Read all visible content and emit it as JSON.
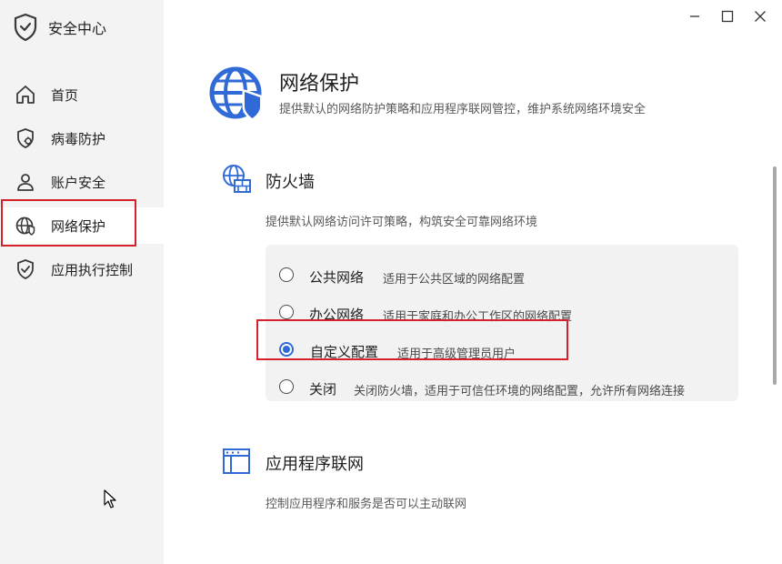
{
  "app": {
    "title": "安全中心"
  },
  "sidebar": {
    "items": [
      {
        "label": "首页",
        "icon": "home-icon",
        "active": false
      },
      {
        "label": "病毒防护",
        "icon": "shield-virus-icon",
        "active": false
      },
      {
        "label": "账户安全",
        "icon": "user-icon",
        "active": false
      },
      {
        "label": "网络保护",
        "icon": "network-globe-shield-icon",
        "active": true
      },
      {
        "label": "应用执行控制",
        "icon": "shield-check-icon",
        "active": false
      }
    ]
  },
  "window_controls": {
    "minimize": "minimize-icon",
    "maximize": "maximize-icon",
    "close": "close-icon"
  },
  "header": {
    "title": "网络保护",
    "subtitle": "提供默认的网络防护策略和应用程序联网管控，维护系统网络环境安全",
    "icon": "globe-shield-icon"
  },
  "firewall": {
    "title": "防火墙",
    "description": "提供默认网络访问许可策略，构筑安全可靠网络环境",
    "icon": "globe-firewall-icon",
    "selected_index": 2,
    "options": [
      {
        "label": "公共网络",
        "description": "适用于公共区域的网络配置"
      },
      {
        "label": "办公网络",
        "description": "适用于家庭和办公工作区的网络配置"
      },
      {
        "label": "自定义配置",
        "description": "适用于高级管理员用户"
      },
      {
        "label": "关闭",
        "description": "关闭防火墙，适用于可信任环境的网络配置，允许所有网络连接"
      }
    ]
  },
  "app_network": {
    "title": "应用程序联网",
    "description": "控制应用程序和服务是否可以主动联网",
    "icon": "app-window-icon"
  },
  "colors": {
    "accent": "#2f6ad6",
    "highlight": "#d6202a",
    "sidebar_bg": "#f3f3f3"
  }
}
